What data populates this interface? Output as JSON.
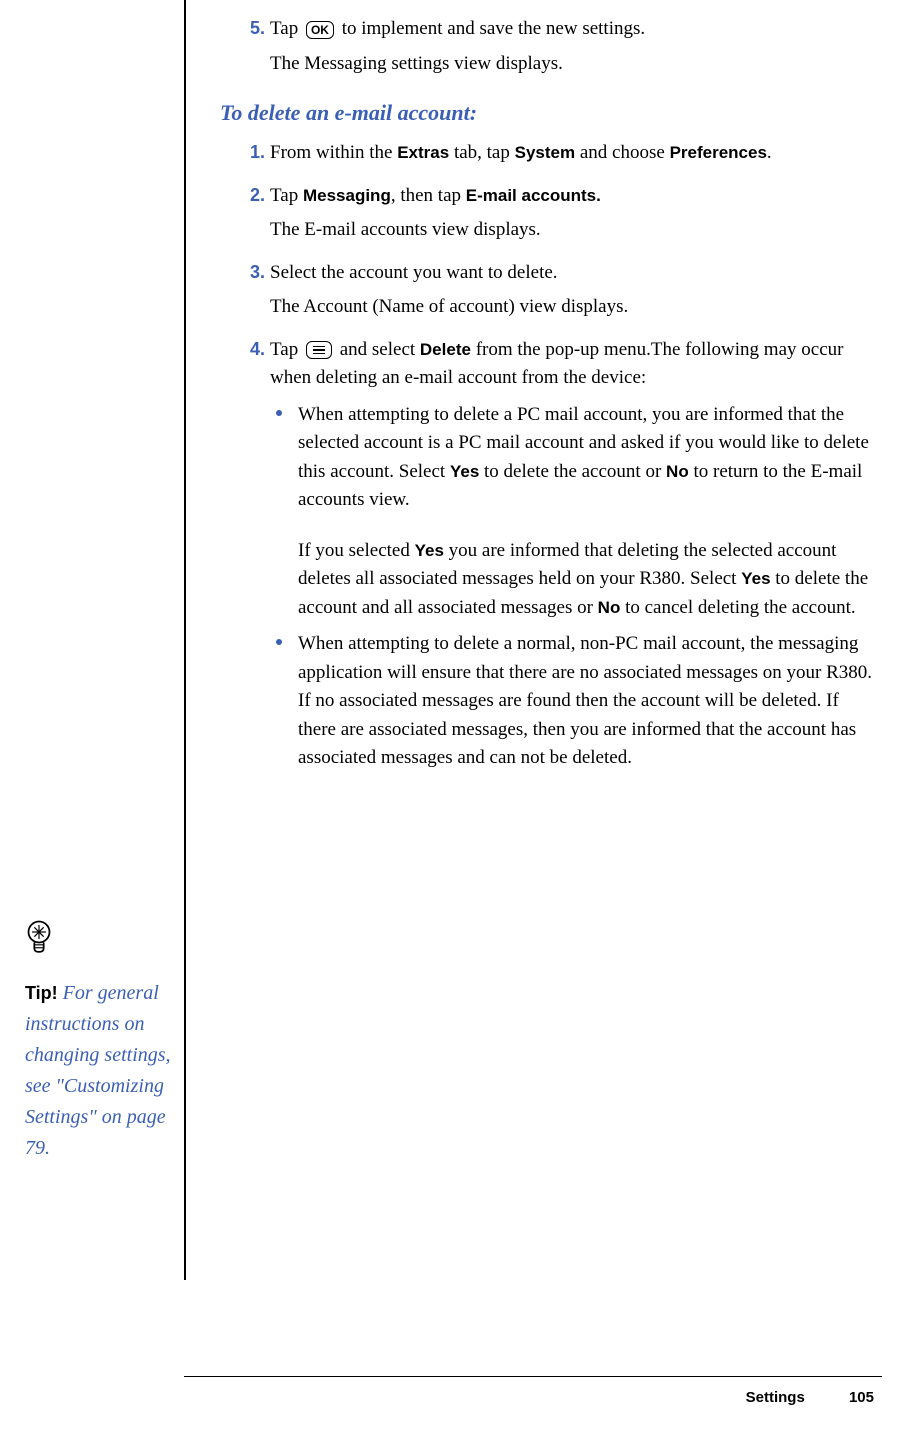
{
  "sidebar": {
    "tip_label": "Tip!",
    "tip_text": " For general instructions on changing settings, see \"Customizing Settings\" on page 79."
  },
  "main": {
    "step5": {
      "num": "5.",
      "pre": "Tap ",
      "post": " to implement and save the new settings.",
      "follow": "The Messaging settings view displays."
    },
    "heading": "To delete an e-mail account:",
    "step1": {
      "num": "1.",
      "t1": "From within the ",
      "b1": "Extras",
      "t2": " tab, tap ",
      "b2": "System",
      "t3": " and choose ",
      "b3": "Preferences",
      "t4": "."
    },
    "step2": {
      "num": "2.",
      "t1": "Tap ",
      "b1": "Messaging",
      "t2": ", then tap ",
      "b2": "E-mail accounts.",
      "follow": "The E-mail accounts view displays."
    },
    "step3": {
      "num": "3.",
      "t1": "Select the account you want to delete.",
      "follow": "The Account (Name of account) view displays."
    },
    "step4": {
      "num": "4.",
      "t1": "Tap ",
      "t2": " and select ",
      "b1": "Delete",
      "t3": " from the pop-up menu.The following may occur when deleting an e-mail account from the device:",
      "bullet1": {
        "t1": "When attempting to delete a PC mail account, you are informed that the selected account is a PC mail account and asked if you would like to delete this account. Select ",
        "b1": "Yes",
        "t2": " to delete the account or ",
        "b2": "No",
        "t3": " to return to the E-mail accounts view.",
        "p2_t1": "If you selected ",
        "p2_b1": "Yes",
        "p2_t2": " you are informed that deleting the selected account deletes all associated messages held on your R380. Select ",
        "p2_b2": "Yes",
        "p2_t3": " to delete the account and all associated messages or ",
        "p2_b3": "No",
        "p2_t4": " to cancel deleting the account."
      },
      "bullet2": {
        "t1": "When attempting to delete a normal, non-PC mail account, the messaging application will ensure that there are no associated messages on your R380. If no associated messages are found then the account will be deleted. If there are associated messages, then you are informed that the account has associated messages and can not be deleted."
      }
    }
  },
  "footer": {
    "section": "Settings",
    "page": "105"
  },
  "icons": {
    "ok": "OK"
  }
}
